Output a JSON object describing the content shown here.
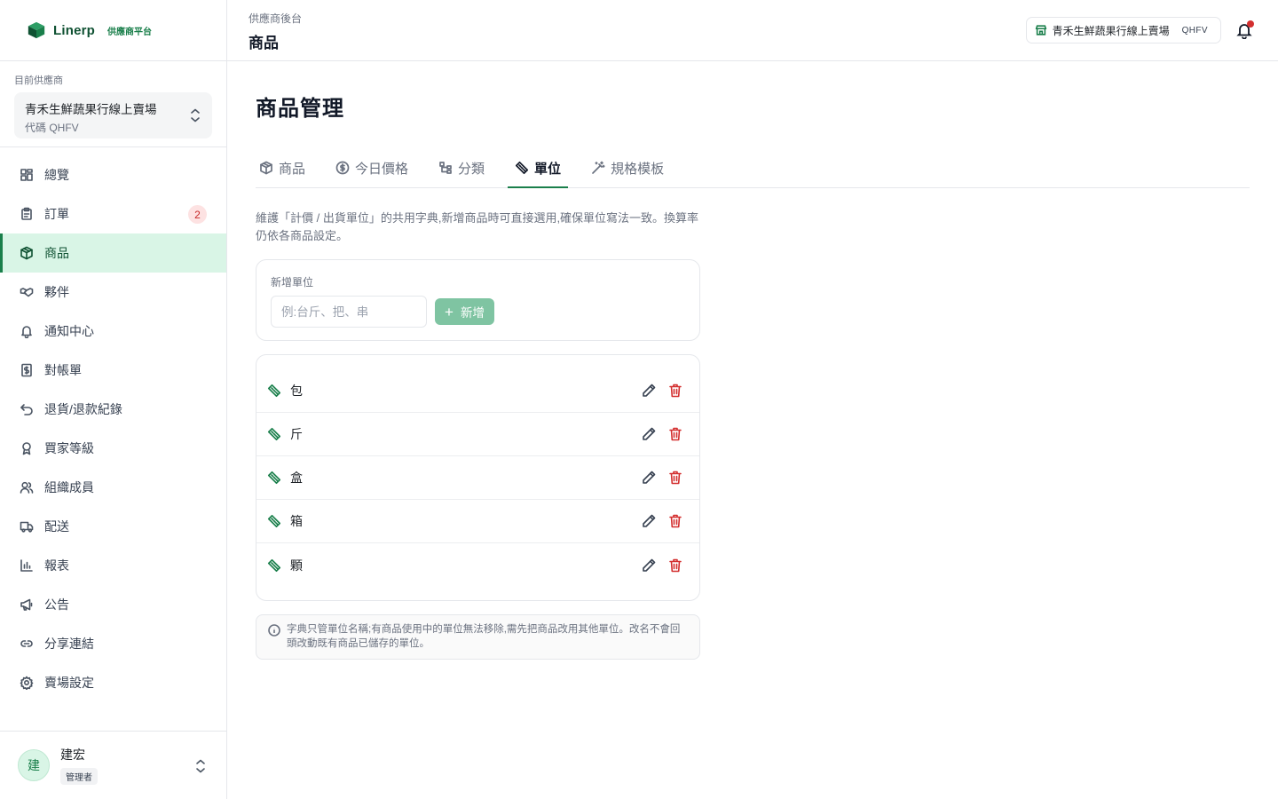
{
  "brand": {
    "name": "Linerp",
    "tag": "供應商平台",
    "color": "#1a7f4b"
  },
  "supplier": {
    "label": "目前供應商",
    "name": "青禾生鮮蔬果行線上賣場",
    "code": "代碼 QHFV"
  },
  "nav": [
    {
      "label": "總覽",
      "icon": "dashboard-icon"
    },
    {
      "label": "訂單",
      "icon": "clipboard-icon",
      "badge": "2"
    },
    {
      "label": "商品",
      "icon": "package-icon",
      "active": true
    },
    {
      "label": "夥伴",
      "icon": "handshake-icon"
    },
    {
      "label": "通知中心",
      "icon": "bell-icon"
    },
    {
      "label": "對帳單",
      "icon": "receipt-icon"
    },
    {
      "label": "退貨/退款紀錄",
      "icon": "undo-icon"
    },
    {
      "label": "買家等級",
      "icon": "award-icon"
    },
    {
      "label": "組織成員",
      "icon": "users-icon"
    },
    {
      "label": "配送",
      "icon": "truck-icon"
    },
    {
      "label": "報表",
      "icon": "bar-chart-icon"
    },
    {
      "label": "公告",
      "icon": "megaphone-icon"
    },
    {
      "label": "分享連結",
      "icon": "link-icon"
    },
    {
      "label": "賣場設定",
      "icon": "gear-icon"
    }
  ],
  "user": {
    "avatar": "建",
    "name": "建宏",
    "role": "管理者"
  },
  "topbar": {
    "crumb": "供應商後台",
    "title": "商品",
    "store_name": "青禾生鮮蔬果行線上賣場",
    "store_code": "QHFV"
  },
  "main": {
    "heading": "商品管理",
    "tabs": [
      {
        "label": "商品",
        "icon": "package-icon"
      },
      {
        "label": "今日價格",
        "icon": "dollar-circle-icon"
      },
      {
        "label": "分類",
        "icon": "tree-icon"
      },
      {
        "label": "單位",
        "icon": "ruler-icon",
        "active": true
      },
      {
        "label": "規格模板",
        "icon": "magic-wand-icon"
      }
    ],
    "description": "維護「計價 / 出貨單位」的共用字典,新增商品時可直接選用,確保單位寫法一致。換算率仍依各商品設定。",
    "add": {
      "label": "新增單位",
      "placeholder": "例:台斤、把、串",
      "button": "新增"
    },
    "units": [
      "包",
      "斤",
      "盒",
      "箱",
      "顆"
    ],
    "note": "字典只管單位名稱;有商品使用中的單位無法移除,需先把商品改用其他單位。改名不會回頭改動既有商品已儲存的單位。"
  }
}
